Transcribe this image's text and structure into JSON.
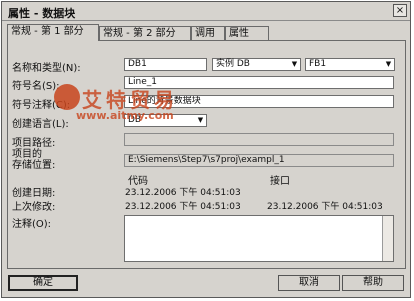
{
  "window": {
    "title": "属性 - 数据块",
    "close_glyph": "×"
  },
  "tabs": [
    {
      "label": "常规 - 第 1 部分"
    },
    {
      "label": "常规 - 第 2 部分"
    },
    {
      "label": "调用"
    },
    {
      "label": "属性"
    }
  ],
  "form": {
    "name_type_label": "名称和类型(N):",
    "name_value": "DB1",
    "type_value": "实例 DB",
    "fb_value": "FB1",
    "symbol_label": "符号名(S):",
    "symbol_value": "Line_1",
    "symbol_comment_label": "符号注释(C):",
    "symbol_comment_value": "Line的背景数据块",
    "language_label": "创建语言(L):",
    "language_value": "DB",
    "project_path_label": "项目路径:",
    "project_path_value": "",
    "storage_label_1": "项目的",
    "storage_label_2": "存储位置:",
    "storage_value": "E:\\Siemens\\Step7\\s7proj\\exampl_1",
    "col_code": "代码",
    "col_interface": "接口",
    "created_label": "创建日期:",
    "created_code": "23.12.2006  下午 04:51:03",
    "modified_label": "上次修改:",
    "modified_code": "23.12.2006  下午 04:51:03",
    "modified_interface": "23.12.2006  下午 04:51:03",
    "comment_label": "注释(O):",
    "comment_value": ""
  },
  "buttons": {
    "ok": "确定",
    "cancel": "取消",
    "help": "帮助"
  },
  "watermark": {
    "name": "艾特贸易",
    "url": "www.aitmy.com"
  },
  "colors": {
    "dialog_bg": "#d6d3ce",
    "watermark": "#c8441c"
  }
}
